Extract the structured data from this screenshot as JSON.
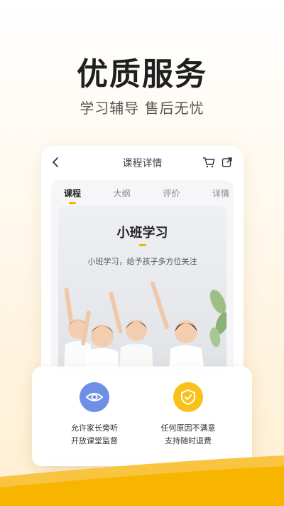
{
  "headline": "优质服务",
  "subline": "学习辅导 售后无忧",
  "phone": {
    "title": "课程详情",
    "tabs": [
      {
        "label": "课程",
        "active": true
      },
      {
        "label": "大纲",
        "active": false
      },
      {
        "label": "评价",
        "active": false
      },
      {
        "label": "详情",
        "active": false
      }
    ],
    "photo": {
      "title": "小班学习",
      "description": "小班学习，给予孩子多方位关注"
    }
  },
  "features": [
    {
      "icon": "eye-icon",
      "line1": "允许家长旁听",
      "line2": "开放课堂监督",
      "color": "#6f8fe6"
    },
    {
      "icon": "shield-check-icon",
      "line1": "任何原因不满意",
      "line2": "支持随时退费",
      "color": "#f8c21a"
    }
  ],
  "colors": {
    "accent": "#f7b500",
    "wave": "#f7b500"
  }
}
